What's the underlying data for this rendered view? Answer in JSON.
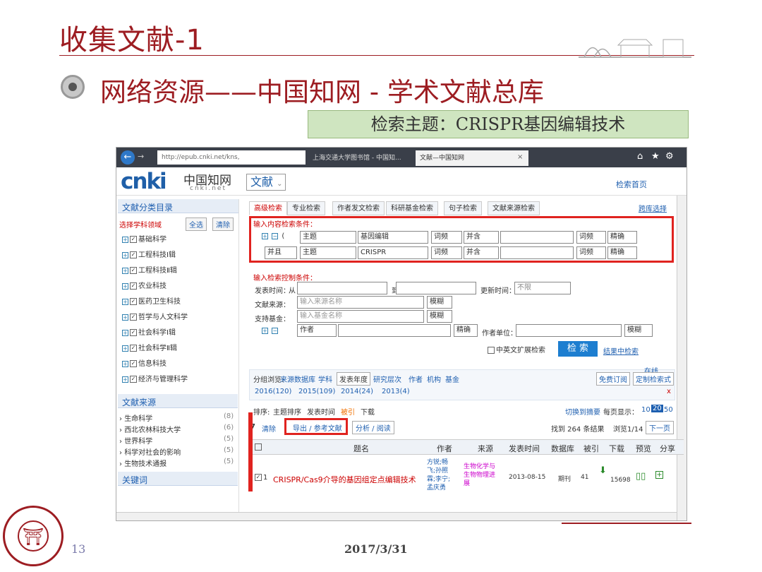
{
  "slide": {
    "title": "收集文献-1",
    "subtitle": "网络资源——中国知网 - 学术文献总库",
    "topic": "检索主题：CRISPR基因编辑技术",
    "page": "13",
    "date": "2017/3/31"
  },
  "browser": {
    "url": "http://epub.cnki.net/kns, ",
    "tabs": [
      "上海交通大学图书馆 - 中国知...",
      "文献—中国知网"
    ],
    "close_mark": "×"
  },
  "cnki": {
    "logo_en": "cnki",
    "logo_cn": "中国知网",
    "logo_sub": "cnki.net",
    "db_select": "文献",
    "home_link": "检索首页"
  },
  "sidebar": {
    "catalog_title": "文献分类目录",
    "select_field": "选择学科领域",
    "all_btn": "全选",
    "clear_btn": "清除",
    "fields": [
      "基础科学",
      "工程科技Ⅰ辑",
      "工程科技Ⅱ辑",
      "农业科技",
      "医药卫生科技",
      "哲学与人文科学",
      "社会科学Ⅰ辑",
      "社会科学Ⅱ辑",
      "信息科技",
      "经济与管理科学"
    ],
    "source_title": "文献来源",
    "sources": [
      {
        "name": "生命科学",
        "count": "(8)"
      },
      {
        "name": "西北农林科技大学",
        "count": "(6)"
      },
      {
        "name": "世界科学",
        "count": "(5)"
      },
      {
        "name": "科学对社会的影响",
        "count": "(5)"
      },
      {
        "name": "生物技术通报",
        "count": "(5)"
      }
    ],
    "keyword_title": "关键词"
  },
  "search": {
    "tabs": [
      "高级检索",
      "专业检索",
      "作者发文检索",
      "科研基金检索",
      "句子检索",
      "文献来源检索"
    ],
    "cross_db": "跨库选择",
    "content_label": "输入内容检索条件：",
    "row1": {
      "field": "主题",
      "value": "基因编辑",
      "freq": "词频",
      "logic": "并含",
      "freq2": "词频",
      "match": "精确"
    },
    "row2": {
      "op": "并且",
      "field": "主题",
      "value": "CRISPR",
      "freq": "词频",
      "logic": "并含",
      "freq2": "词频",
      "match": "精确"
    },
    "control_label": "输入检索控制条件：",
    "pub_time_label": "发表时间：",
    "from": "从",
    "to": "到",
    "update_label": "更新时间：",
    "update_value": "不限",
    "source_label": "文献来源：",
    "source_placeholder": "输入来源名称",
    "fund_label": "支持基金：",
    "fund_placeholder": "输入基金名称",
    "fuzzy": "模糊",
    "author_label": "作者",
    "exact": "精确",
    "author_unit": "作者单位：",
    "cn_en": "中英文扩展检索",
    "search_btn": "检 索",
    "result_search": "结果中检索"
  },
  "results": {
    "group_label": "分组浏览:",
    "groups": [
      "来源数据库",
      "学科",
      "发表年度",
      "研究层次",
      "作者",
      "机构",
      "基金"
    ],
    "free_sub": "免费订阅",
    "custom": "定制检索式",
    "online": "在线",
    "years": [
      "2016(120)",
      "2015(109)",
      "2014(24)",
      "2013(4)"
    ],
    "close": "x",
    "sort_label": "排序:",
    "sorts": [
      "主题排序",
      "发表时间",
      "被引",
      "下载"
    ],
    "switch": "切换到摘要",
    "per_page": "每页显示：",
    "per_page_opts": [
      "10",
      "20",
      "50"
    ],
    "selected_count": "7",
    "clear": "清除",
    "export": "导出 / 参考文献",
    "analyze": "分析 / 阅读",
    "found": "找到 264 条结果",
    "page_info": "浏览1/14",
    "next": "下一页",
    "headers": [
      "题名",
      "作者",
      "来源",
      "发表时间",
      "数据库",
      "被引",
      "下载",
      "预览",
      "分享"
    ],
    "row": {
      "num": "1",
      "title": "CRISPR/Cas9介导的基因组定点编辑技术",
      "authors": "方锐;畅飞;孙照霖;李宁;孟庆勇",
      "source": "生物化学与生物物理进展",
      "date": "2013-08-15",
      "db": "期刊",
      "cited": "41",
      "downloads": "15698"
    }
  }
}
